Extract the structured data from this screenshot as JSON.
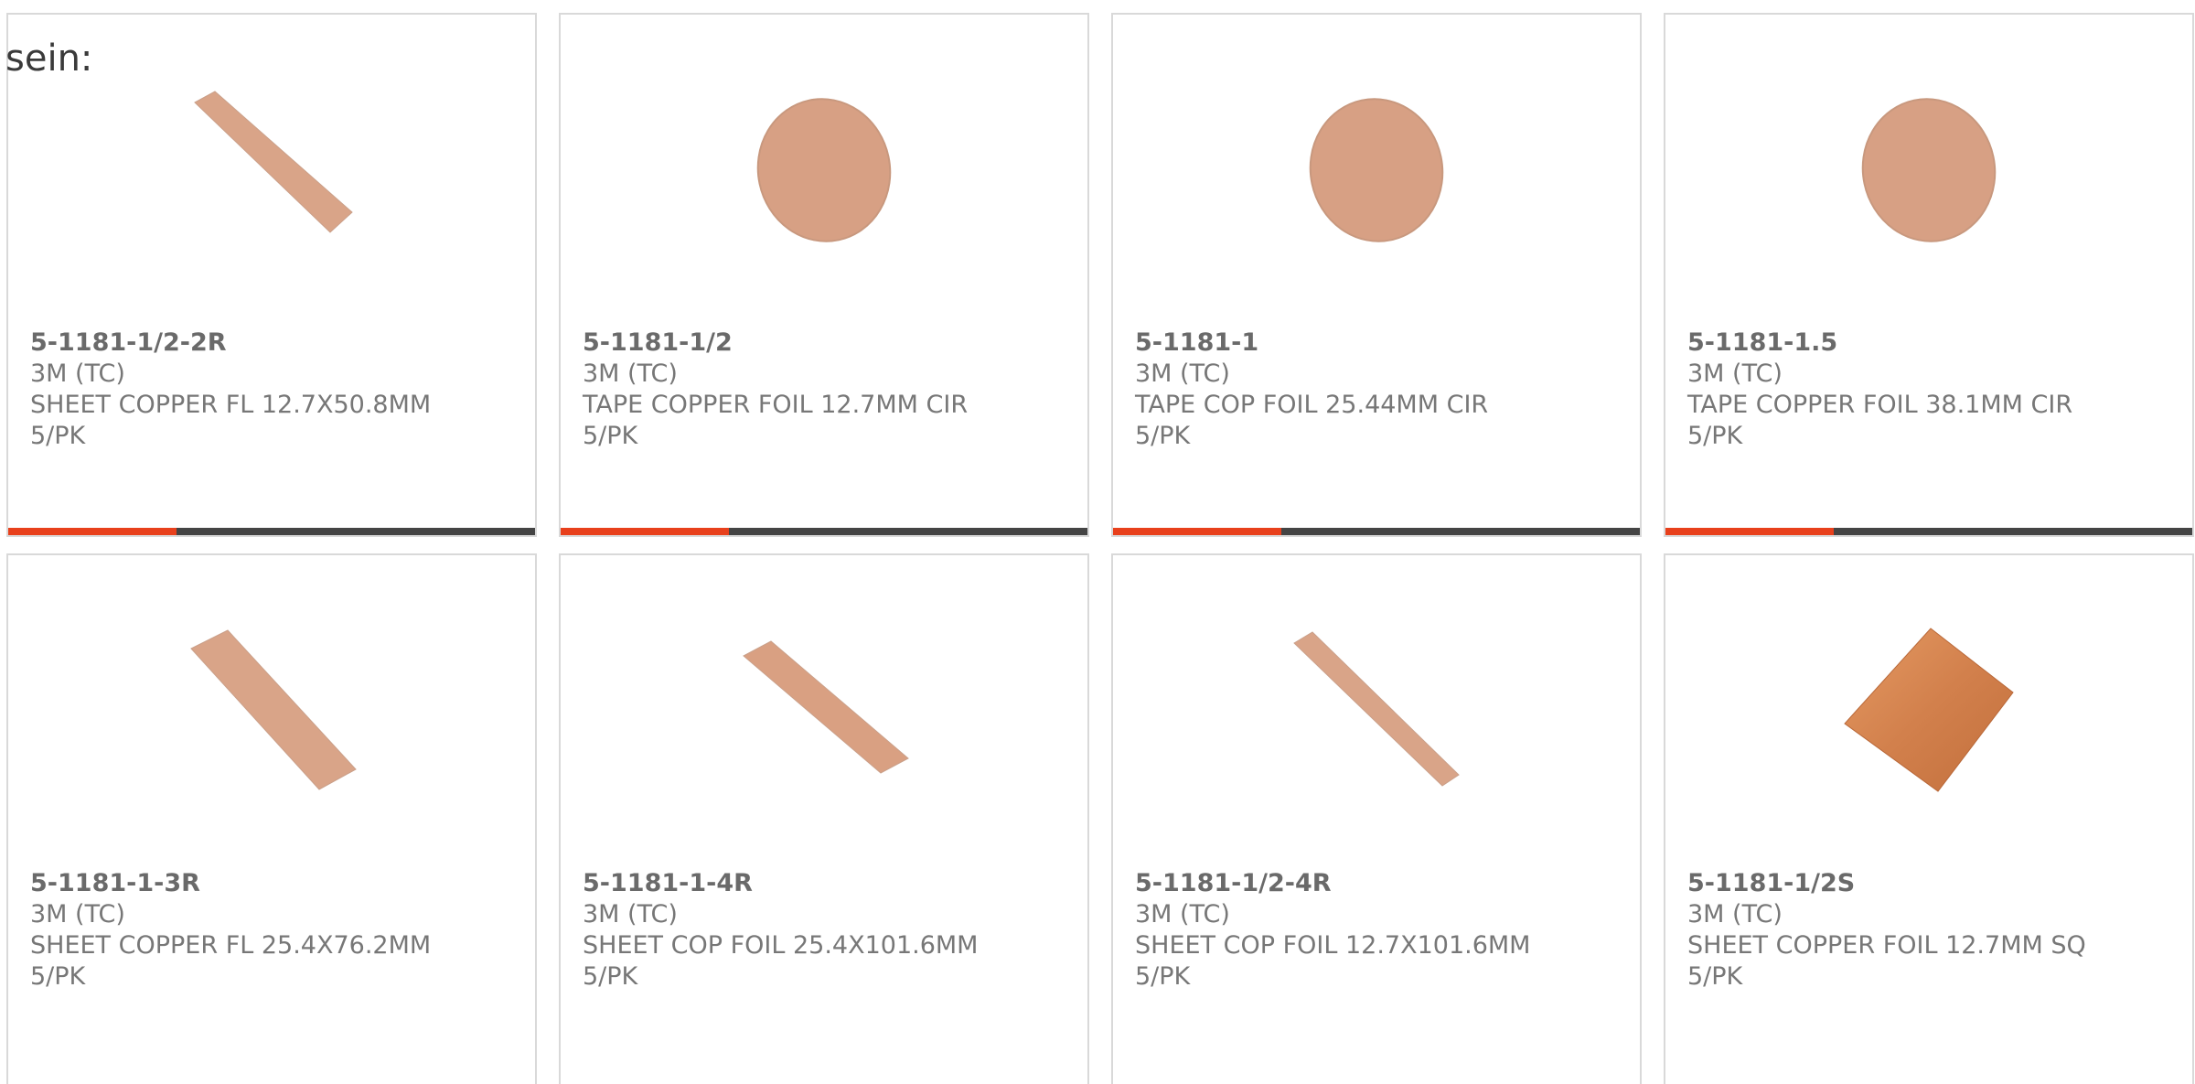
{
  "heading": "sein:",
  "colors": {
    "accent": "#e8401c",
    "bar": "#444444",
    "copper_light": "#d9a488",
    "copper_bright": "#d9824a"
  },
  "products": [
    {
      "part": "5-1181-1/2-2R",
      "brand": "3M (TC)",
      "desc": "SHEET COPPER FL 12.7X50.8MM",
      "pack": "5/PK",
      "shape": "strip"
    },
    {
      "part": "5-1181-1/2",
      "brand": "3M (TC)",
      "desc": "TAPE COPPER FOIL 12.7MM CIR",
      "pack": "5/PK",
      "shape": "disc"
    },
    {
      "part": "5-1181-1",
      "brand": "3M (TC)",
      "desc": "TAPE COP FOIL 25.44MM CIR",
      "pack": "5/PK",
      "shape": "disc"
    },
    {
      "part": "5-1181-1.5",
      "brand": "3M (TC)",
      "desc": "TAPE COPPER FOIL 38.1MM CIR",
      "pack": "5/PK",
      "shape": "disc"
    },
    {
      "part": "5-1181-1-3R",
      "brand": "3M (TC)",
      "desc": "SHEET COPPER FL 25.4X76.2MM",
      "pack": "5/PK",
      "shape": "wide-strip"
    },
    {
      "part": "5-1181-1-4R",
      "brand": "3M (TC)",
      "desc": "SHEET COP FOIL 25.4X101.6MM",
      "pack": "5/PK",
      "shape": "strip"
    },
    {
      "part": "5-1181-1/2-4R",
      "brand": "3M (TC)",
      "desc": "SHEET COP FOIL 12.7X101.6MM",
      "pack": "5/PK",
      "shape": "thin-strip"
    },
    {
      "part": "5-1181-1/2S",
      "brand": "3M (TC)",
      "desc": "SHEET COPPER FOIL 12.7MM SQ",
      "pack": "5/PK",
      "shape": "square"
    }
  ]
}
